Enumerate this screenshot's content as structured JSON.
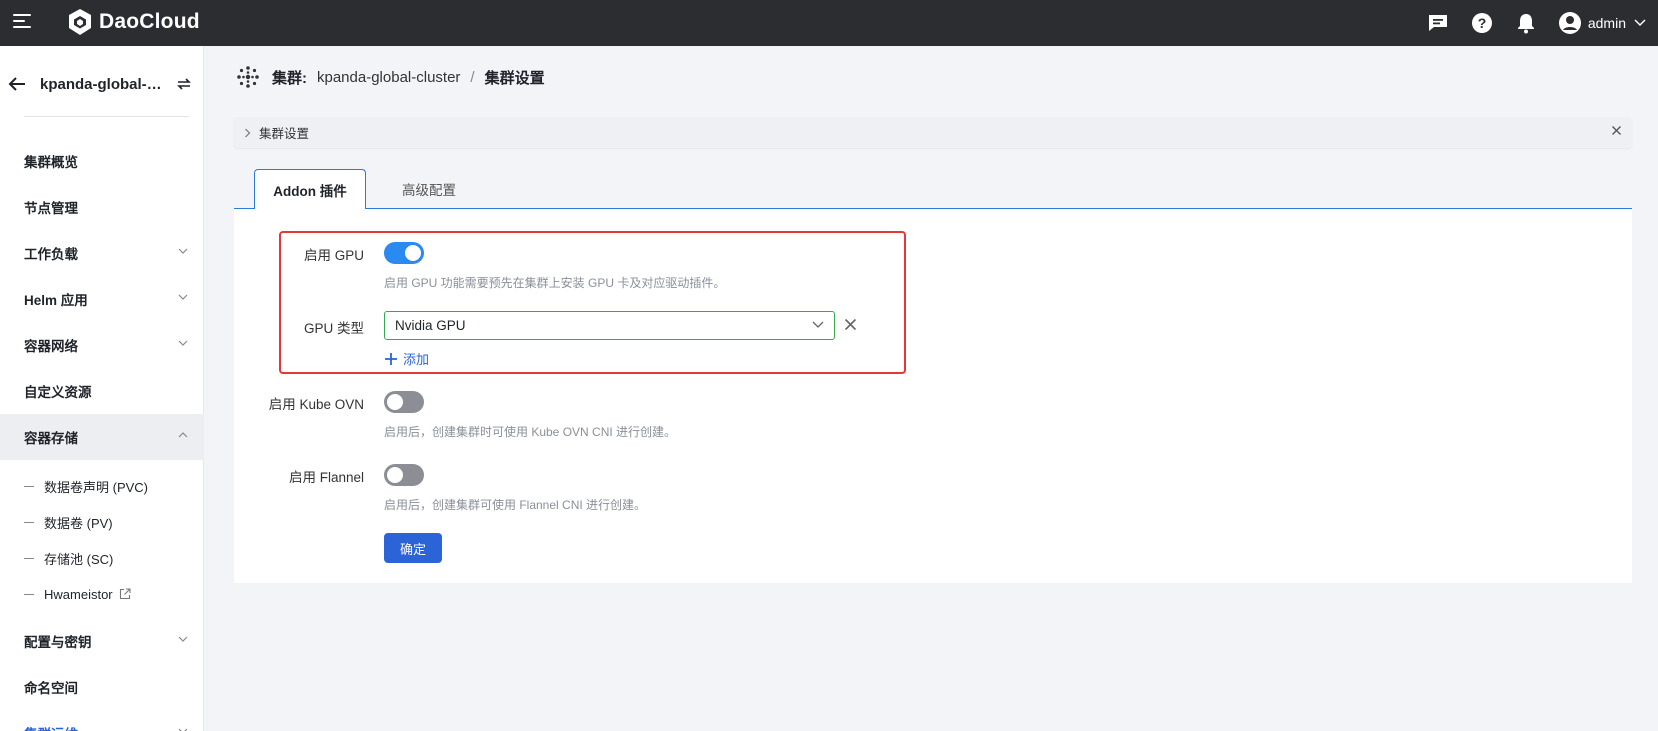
{
  "topbar": {
    "brand": "DaoCloud",
    "username": "admin"
  },
  "sidebar": {
    "cluster_name": "kpanda-global-cl...",
    "items": [
      {
        "label": "集群概览",
        "has_chevron": false
      },
      {
        "label": "节点管理",
        "has_chevron": false
      },
      {
        "label": "工作负载",
        "has_chevron": true
      },
      {
        "label": "Helm 应用",
        "has_chevron": true
      },
      {
        "label": "容器网络",
        "has_chevron": true
      },
      {
        "label": "自定义资源",
        "has_chevron": false
      },
      {
        "label": "容器存储",
        "has_chevron": true,
        "expanded": true
      }
    ],
    "sub_items": [
      {
        "label": "数据卷声明 (PVC)"
      },
      {
        "label": "数据卷 (PV)"
      },
      {
        "label": "存储池 (SC)"
      },
      {
        "label": "Hwameistor",
        "external": true
      }
    ],
    "items_after": [
      {
        "label": "配置与密钥",
        "has_chevron": true
      },
      {
        "label": "命名空间",
        "has_chevron": false
      },
      {
        "label": "集群运维",
        "has_chevron": true,
        "active": true
      }
    ]
  },
  "breadcrumb": {
    "label": "集群:",
    "cluster": "kpanda-global-cluster",
    "separator": "/",
    "current": "集群设置"
  },
  "collapse_bar": {
    "title": "集群设置"
  },
  "tabs": [
    {
      "label": "Addon 插件",
      "active": true
    },
    {
      "label": "高级配置",
      "active": false
    }
  ],
  "form": {
    "gpu": {
      "label": "启用 GPU",
      "enabled": true,
      "hint": "启用 GPU 功能需要预先在集群上安装 GPU 卡及对应驱动插件。"
    },
    "gpu_type": {
      "label": "GPU 类型",
      "value": "Nvidia GPU",
      "add_label": "添加"
    },
    "kube_ovn": {
      "label": "启用 Kube OVN",
      "enabled": false,
      "hint": "启用后，创建集群时可使用 Kube OVN CNI 进行创建。"
    },
    "flannel": {
      "label": "启用 Flannel",
      "enabled": false,
      "hint": "启用后，创建集群可使用 Flannel CNI 进行创建。"
    },
    "confirm_label": "确定"
  },
  "colors": {
    "topbar": "#2b2d30",
    "primary": "#2a64d6",
    "toggle_on": "#2a8af0",
    "highlight_box": "#e23a33",
    "select_border": "#36a852"
  }
}
